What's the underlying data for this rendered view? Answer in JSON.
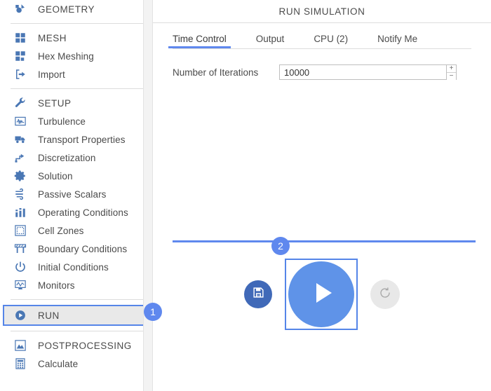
{
  "sidebar": {
    "groups": [
      {
        "items": [
          {
            "label": "GEOMETRY",
            "icon": "geometry-icon",
            "type": "header"
          }
        ]
      },
      {
        "items": [
          {
            "label": "MESH",
            "icon": "mesh-icon",
            "type": "header"
          },
          {
            "label": "Hex Meshing",
            "icon": "hex-meshing-icon",
            "type": "item"
          },
          {
            "label": "Import",
            "icon": "import-icon",
            "type": "item"
          }
        ]
      },
      {
        "items": [
          {
            "label": "SETUP",
            "icon": "wrench-icon",
            "type": "header"
          },
          {
            "label": "Turbulence",
            "icon": "turbulence-icon",
            "type": "item"
          },
          {
            "label": "Transport Properties",
            "icon": "truck-icon",
            "type": "item"
          },
          {
            "label": "Discretization",
            "icon": "discretization-icon",
            "type": "item"
          },
          {
            "label": "Solution",
            "icon": "gear-icon",
            "type": "item"
          },
          {
            "label": "Passive Scalars",
            "icon": "wind-icon",
            "type": "item"
          },
          {
            "label": "Operating Conditions",
            "icon": "bar-chart-icon",
            "type": "item"
          },
          {
            "label": "Cell Zones",
            "icon": "cell-zones-icon",
            "type": "item"
          },
          {
            "label": "Boundary Conditions",
            "icon": "boundary-conditions-icon",
            "type": "item"
          },
          {
            "label": "Initial Conditions",
            "icon": "power-icon",
            "type": "item"
          },
          {
            "label": "Monitors",
            "icon": "monitor-icon",
            "type": "item"
          }
        ]
      },
      {
        "items": [
          {
            "label": "RUN",
            "icon": "play-circle-icon",
            "type": "header",
            "selected": true
          }
        ]
      },
      {
        "items": [
          {
            "label": "POSTPROCESSING",
            "icon": "postprocessing-icon",
            "type": "header"
          },
          {
            "label": "Calculate",
            "icon": "calculator-icon",
            "type": "item"
          }
        ]
      }
    ]
  },
  "badges": {
    "step1": "1",
    "step2": "2"
  },
  "main": {
    "title": "RUN SIMULATION",
    "tabs": [
      {
        "label": "Time Control",
        "active": true
      },
      {
        "label": "Output",
        "active": false
      },
      {
        "label": "CPU  (2)",
        "active": false
      },
      {
        "label": "Notify Me",
        "active": false
      }
    ],
    "form": {
      "iterations_label": "Number of Iterations",
      "iterations_value": "10000",
      "iterations_placeholder": "10000",
      "spinner_up": "+",
      "spinner_down": "−"
    },
    "actions": {
      "save_icon": "floppy-disk-icon",
      "play_icon": "play-icon",
      "reset_icon": "reset-icon"
    }
  },
  "colors": {
    "accent": "#5f88ee",
    "play": "#5f93e8",
    "save": "#4069b8",
    "icon_blue": "#4a77b4",
    "selected_bg": "#e9e9e9",
    "reset_bg": "#e8e8e8"
  }
}
